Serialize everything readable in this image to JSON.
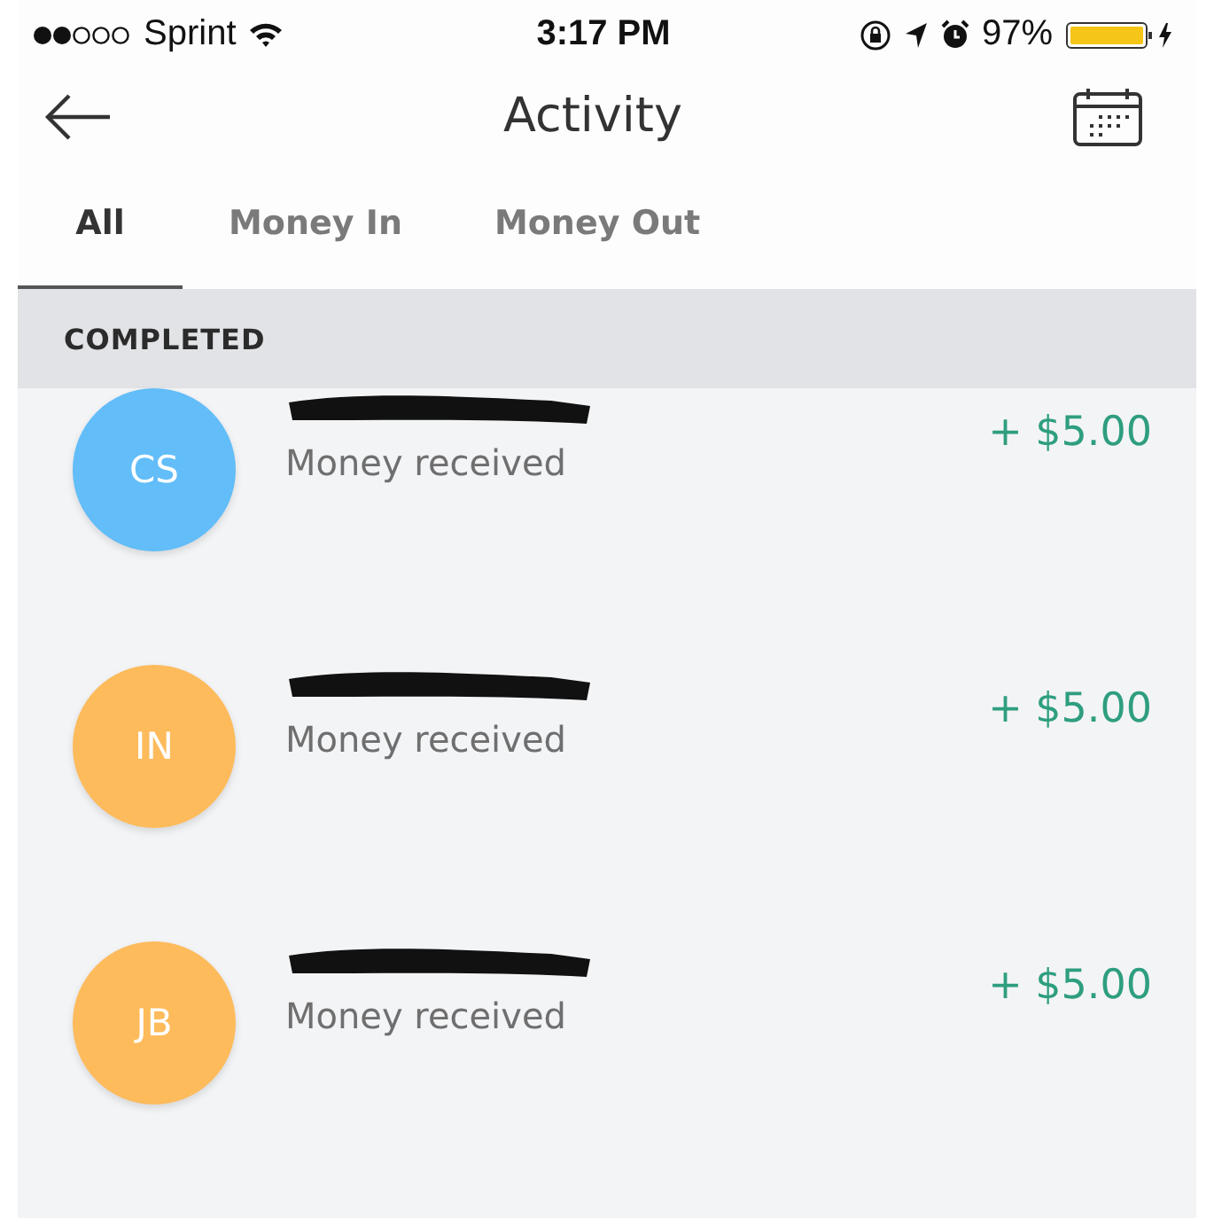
{
  "status_bar": {
    "carrier": "Sprint",
    "time": "3:17 PM",
    "battery": "97%"
  },
  "header": {
    "title": "Activity"
  },
  "tabs": [
    {
      "label": "All",
      "selected": true
    },
    {
      "label": "Money In",
      "selected": false
    },
    {
      "label": "Money Out",
      "selected": false
    }
  ],
  "section": {
    "title": "COMPLETED"
  },
  "transactions": [
    {
      "initials": "CS",
      "color": "#62bdf8",
      "description": "Money received",
      "amount": "+ $5.00"
    },
    {
      "initials": "IN",
      "color": "#fdbb5c",
      "description": "Money received",
      "amount": "+ $5.00"
    },
    {
      "initials": "JB",
      "color": "#fdbb5c",
      "description": "Money received",
      "amount": "+ $5.00"
    }
  ]
}
